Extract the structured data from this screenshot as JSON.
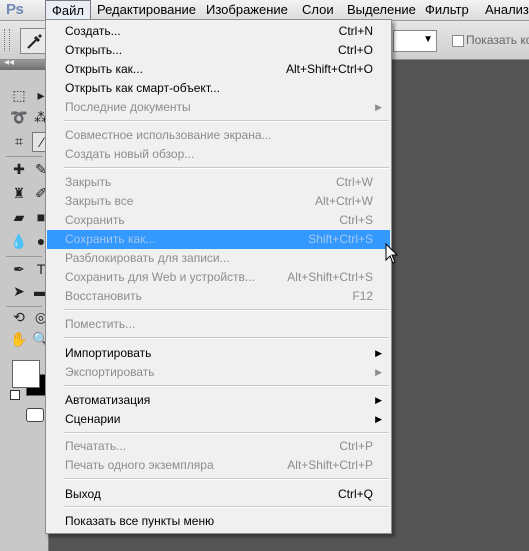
{
  "app": {
    "logo": "Ps"
  },
  "menubar": {
    "items": [
      "Файл",
      "Редактирование",
      "Изображение",
      "Слои",
      "Выделение",
      "Фильтр",
      "Анализ"
    ]
  },
  "options": {
    "show_all_label": "Показать кол"
  },
  "file_menu": {
    "items": [
      {
        "label": "Создать...",
        "shortcut": "Ctrl+N",
        "enabled": true
      },
      {
        "label": "Открыть...",
        "shortcut": "Ctrl+O",
        "enabled": true
      },
      {
        "label": "Открыть как...",
        "shortcut": "Alt+Shift+Ctrl+O",
        "enabled": true
      },
      {
        "label": "Открыть как смарт-объект...",
        "shortcut": "",
        "enabled": true
      },
      {
        "label": "Последние документы",
        "shortcut": "",
        "enabled": false,
        "submenu": true
      },
      {
        "label": "Совместное использование экрана...",
        "shortcut": "",
        "enabled": false
      },
      {
        "label": "Создать новый обзор...",
        "shortcut": "",
        "enabled": false
      },
      {
        "label": "Закрыть",
        "shortcut": "Ctrl+W",
        "enabled": false
      },
      {
        "label": "Закрыть все",
        "shortcut": "Alt+Ctrl+W",
        "enabled": false
      },
      {
        "label": "Сохранить",
        "shortcut": "Ctrl+S",
        "enabled": false
      },
      {
        "label": "Сохранить как...",
        "shortcut": "Shift+Ctrl+S",
        "enabled": false,
        "highlighted": true
      },
      {
        "label": "Разблокировать для записи...",
        "shortcut": "",
        "enabled": false
      },
      {
        "label": "Сохранить для Web и устройств...",
        "shortcut": "Alt+Shift+Ctrl+S",
        "enabled": false
      },
      {
        "label": "Восстановить",
        "shortcut": "F12",
        "enabled": false
      },
      {
        "label": "Поместить...",
        "shortcut": "",
        "enabled": false
      },
      {
        "label": "Импортировать",
        "shortcut": "",
        "enabled": true,
        "submenu": true
      },
      {
        "label": "Экспортировать",
        "shortcut": "",
        "enabled": false,
        "submenu": true
      },
      {
        "label": "Автоматизация",
        "shortcut": "",
        "enabled": true,
        "submenu": true
      },
      {
        "label": "Сценарии",
        "shortcut": "",
        "enabled": true,
        "submenu": true
      },
      {
        "label": "Печатать...",
        "shortcut": "Ctrl+P",
        "enabled": false
      },
      {
        "label": "Печать одного экземпляра",
        "shortcut": "Alt+Shift+Ctrl+P",
        "enabled": false
      },
      {
        "label": "Выход",
        "shortcut": "Ctrl+Q",
        "enabled": true
      },
      {
        "label": "Показать все пункты меню",
        "shortcut": "",
        "enabled": true
      }
    ]
  },
  "colors": {
    "highlight": "#3399ff",
    "disabled_text": "#8d8d8d",
    "workspace": "#545454"
  }
}
